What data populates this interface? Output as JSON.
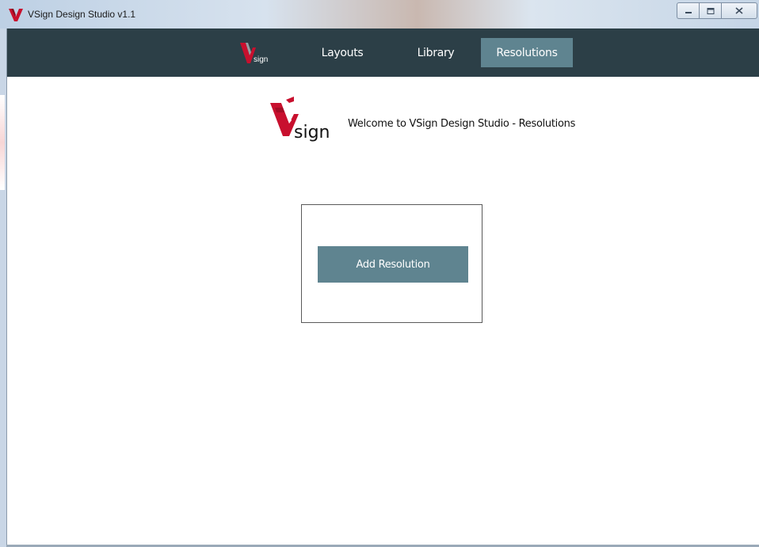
{
  "window": {
    "title": "VSign Design Studio v1.1",
    "controls": [
      "minimize-icon",
      "maximize-icon",
      "close-icon"
    ]
  },
  "nav": {
    "logo_text": "sign",
    "items": [
      {
        "label": "Layouts",
        "active": false
      },
      {
        "label": "Library",
        "active": false
      },
      {
        "label": "Resolutions",
        "active": true
      }
    ]
  },
  "main": {
    "logo_text": "sign",
    "welcome": "Welcome to VSign Design Studio - Resolutions",
    "add_button": "Add Resolution"
  },
  "colors": {
    "nav_bg": "#2c3f47",
    "accent": "#5f8490",
    "brand_red": "#c8102e"
  }
}
